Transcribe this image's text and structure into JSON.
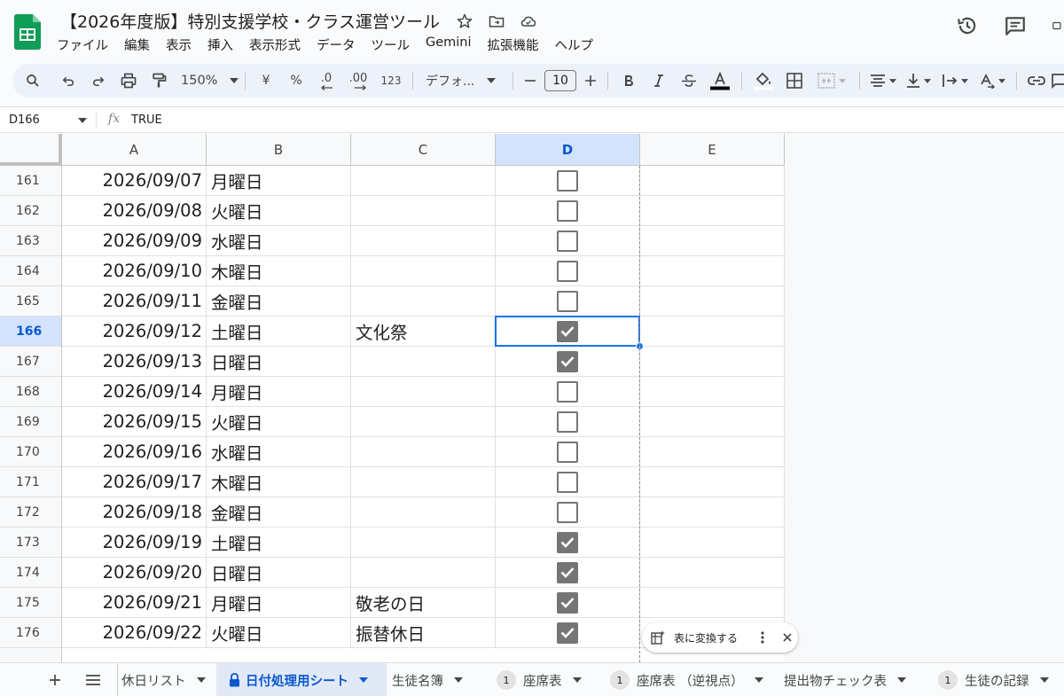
{
  "document": {
    "title": "【2026年度版】特別支援学校・クラス運営ツール"
  },
  "menu": [
    "ファイル",
    "編集",
    "表示",
    "挿入",
    "表示形式",
    "データ",
    "ツール",
    "Gemini",
    "拡張機能",
    "ヘルプ"
  ],
  "toolbar": {
    "zoom": "150%",
    "currency": "¥",
    "percent": "%",
    "dec_decrease": ".0",
    "dec_increase": ".00",
    "number_format": "123",
    "font": "デフォ...",
    "font_size": "10"
  },
  "formula_bar": {
    "cell_ref": "D166",
    "fx": "fx",
    "value": "TRUE"
  },
  "columns": [
    "A",
    "B",
    "C",
    "D",
    "E"
  ],
  "selected_column": "D",
  "selected_row": "166",
  "rows": [
    {
      "num": "161",
      "date": "2026/09/07",
      "day": "月曜日",
      "event": "",
      "checked": false
    },
    {
      "num": "162",
      "date": "2026/09/08",
      "day": "火曜日",
      "event": "",
      "checked": false
    },
    {
      "num": "163",
      "date": "2026/09/09",
      "day": "水曜日",
      "event": "",
      "checked": false
    },
    {
      "num": "164",
      "date": "2026/09/10",
      "day": "木曜日",
      "event": "",
      "checked": false
    },
    {
      "num": "165",
      "date": "2026/09/11",
      "day": "金曜日",
      "event": "",
      "checked": false
    },
    {
      "num": "166",
      "date": "2026/09/12",
      "day": "土曜日",
      "event": "文化祭",
      "checked": true
    },
    {
      "num": "167",
      "date": "2026/09/13",
      "day": "日曜日",
      "event": "",
      "checked": true
    },
    {
      "num": "168",
      "date": "2026/09/14",
      "day": "月曜日",
      "event": "",
      "checked": false
    },
    {
      "num": "169",
      "date": "2026/09/15",
      "day": "火曜日",
      "event": "",
      "checked": false
    },
    {
      "num": "170",
      "date": "2026/09/16",
      "day": "水曜日",
      "event": "",
      "checked": false
    },
    {
      "num": "171",
      "date": "2026/09/17",
      "day": "木曜日",
      "event": "",
      "checked": false
    },
    {
      "num": "172",
      "date": "2026/09/18",
      "day": "金曜日",
      "event": "",
      "checked": false
    },
    {
      "num": "173",
      "date": "2026/09/19",
      "day": "土曜日",
      "event": "",
      "checked": true
    },
    {
      "num": "174",
      "date": "2026/09/20",
      "day": "日曜日",
      "event": "",
      "checked": true
    },
    {
      "num": "175",
      "date": "2026/09/21",
      "day": "月曜日",
      "event": "敬老の日",
      "checked": true
    },
    {
      "num": "176",
      "date": "2026/09/22",
      "day": "火曜日",
      "event": "振替休日",
      "checked": true
    }
  ],
  "chip": {
    "label": "表に変換する"
  },
  "sheet_tabs": [
    {
      "label": "休日リスト",
      "badge": "",
      "locked": false,
      "active": false
    },
    {
      "label": "日付処理用シート",
      "badge": "",
      "locked": true,
      "active": true
    },
    {
      "label": "生徒名簿",
      "badge": "",
      "locked": false,
      "active": false
    },
    {
      "label": "座席表",
      "badge": "1",
      "locked": false,
      "active": false
    },
    {
      "label": "座席表 （逆視点）",
      "badge": "1",
      "locked": false,
      "active": false
    },
    {
      "label": "提出物チェック表",
      "badge": "",
      "locked": false,
      "active": false
    },
    {
      "label": "生徒の記録",
      "badge": "1",
      "locked": false,
      "active": false
    }
  ],
  "colors": {
    "accent": "#1a73e8",
    "sheets_green": "#0f9d58",
    "checkbox": "#757575"
  }
}
